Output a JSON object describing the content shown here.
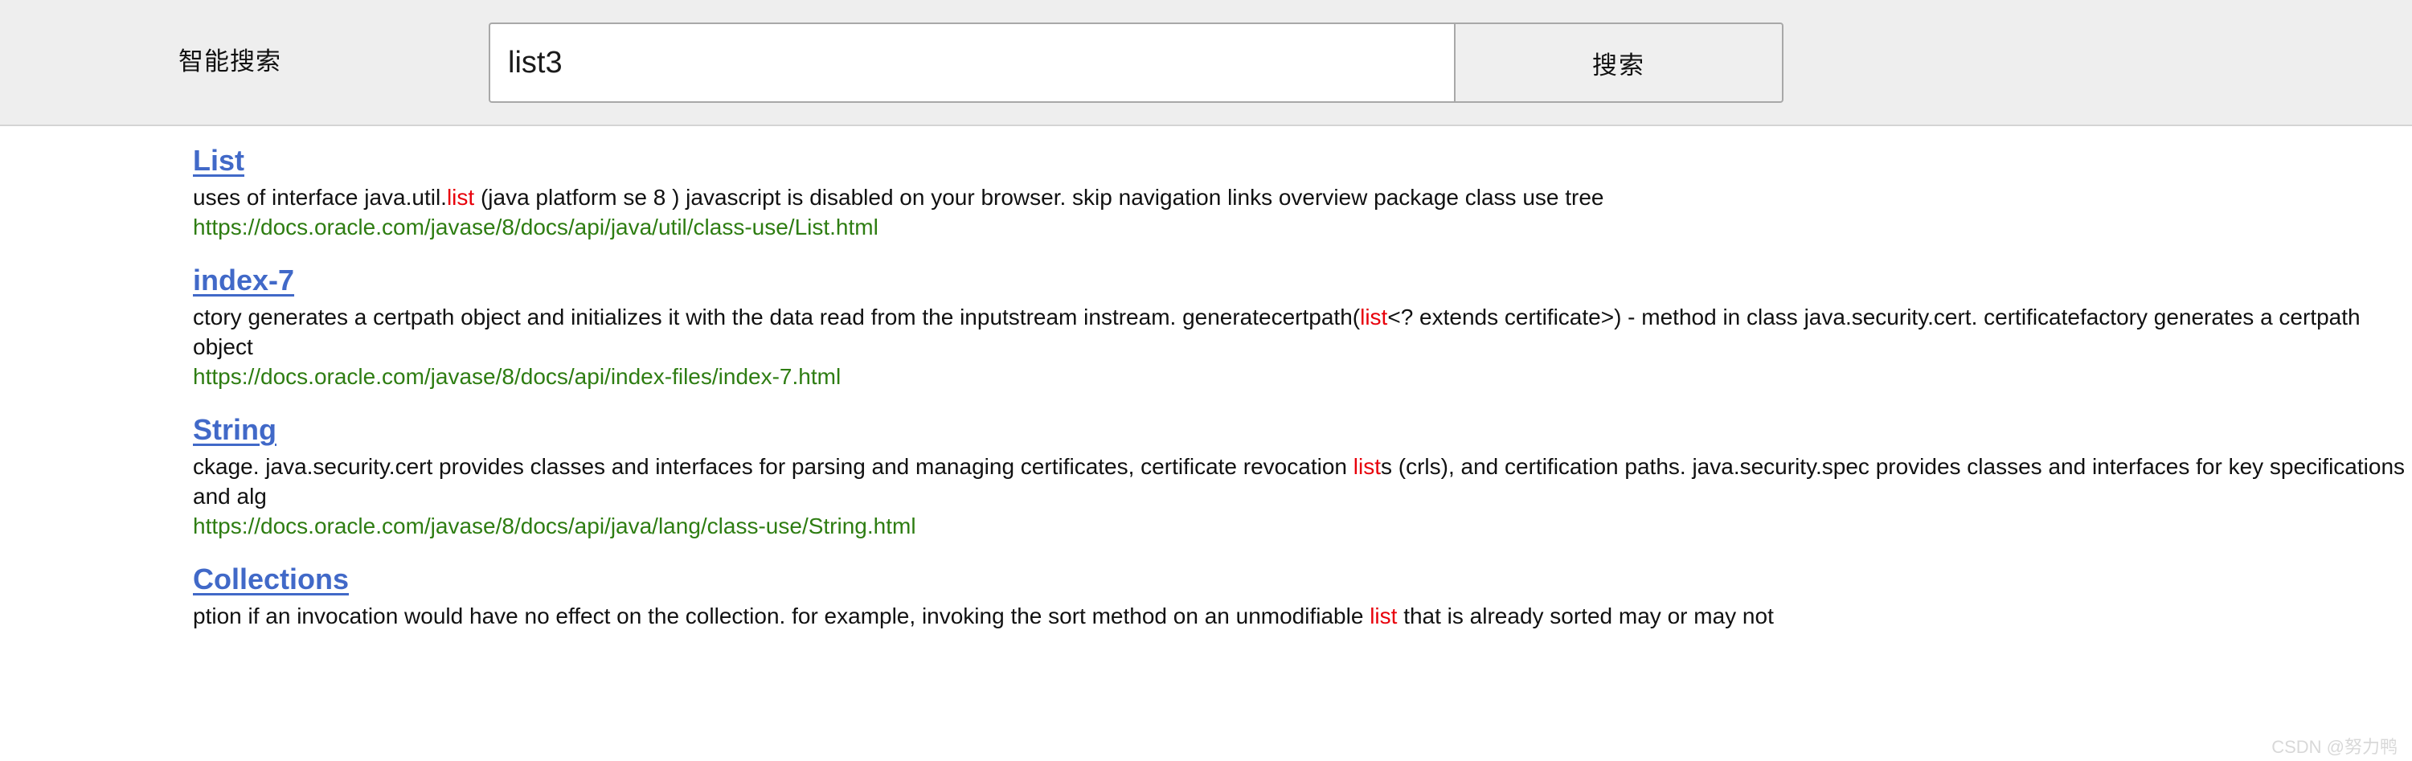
{
  "search": {
    "label": "智能搜索",
    "query_value": "list3",
    "placeholder": "",
    "button_label": "搜索",
    "accent_link_color": "#4169c8",
    "url_color": "#2e7d12",
    "highlight_color": "#e8000b",
    "header_bg": "#eeeeee"
  },
  "watermark": {
    "text": "CSDN @努力鸭"
  },
  "results": [
    {
      "title": "List",
      "snippet_pre": "uses of interface java.util.",
      "snippet_highlight": "list",
      "snippet_post": " (java platform se 8 ) javascript is disabled on your browser. skip navigation links overview package class use tree",
      "url": "https://docs.oracle.com/javase/8/docs/api/java/util/class-use/List.html"
    },
    {
      "title": "index-7",
      "snippet_pre": "ctory generates a certpath object and initializes it with the data read from the inputstream instream. generatecertpath(",
      "snippet_highlight": "list",
      "snippet_post": "<? extends certificate>) - method in class java.security.cert. certificatefactory generates a certpath object",
      "url": "https://docs.oracle.com/javase/8/docs/api/index-files/index-7.html"
    },
    {
      "title": "String",
      "snippet_pre": "ckage. java.security.cert provides classes and interfaces for parsing and managing certificates, certificate revocation ",
      "snippet_highlight": "list",
      "snippet_post": "s (crls), and certification paths. java.security.spec provides classes and interfaces for key specifications and alg",
      "url": "https://docs.oracle.com/javase/8/docs/api/java/lang/class-use/String.html"
    },
    {
      "title": "Collections",
      "snippet_pre": "ption if an invocation would have no effect on the collection. for example, invoking the sort method on an unmodifiable ",
      "snippet_highlight": "list",
      "snippet_post": " that is already sorted may or may not",
      "url": ""
    }
  ]
}
